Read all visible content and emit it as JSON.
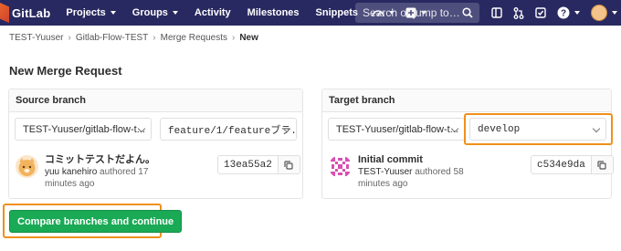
{
  "nav": {
    "brand": "GitLab",
    "items": [
      {
        "label": "Projects",
        "has_caret": true
      },
      {
        "label": "Groups",
        "has_caret": true
      },
      {
        "label": "Activity",
        "has_caret": false
      },
      {
        "label": "Milestones",
        "has_caret": false
      },
      {
        "label": "Snippets",
        "has_caret": false
      }
    ],
    "search_placeholder": "Search or jump to…",
    "icons": [
      "dashboard-icon",
      "plus-icon",
      "search-icon",
      "sidebar-icon",
      "merge-request-icon",
      "todo-icon",
      "help-icon",
      "user-avatar"
    ]
  },
  "breadcrumb": {
    "items": [
      "TEST-Yuuser",
      "Gitlab-Flow-TEST",
      "Merge Requests"
    ],
    "current": "New"
  },
  "page_title": "New Merge Request",
  "source": {
    "heading": "Source branch",
    "project": "TEST-Yuuser/gitlab-flow-t...",
    "branch": "feature/1/featureブラ...",
    "commit": {
      "title": "コミットテストだよん。",
      "author": "yuu kanehiro",
      "meta": "authored 17 minutes ago",
      "sha": "13ea55a2"
    }
  },
  "target": {
    "heading": "Target branch",
    "project": "TEST-Yuuser/gitlab-flow-t...",
    "branch": "develop",
    "commit": {
      "title": "Initial commit",
      "author": "TEST-Yuuser",
      "meta": "authored 58 minutes ago",
      "sha": "c534e9da"
    }
  },
  "compare_button": "Compare branches and continue",
  "colors": {
    "navbar": "#292961",
    "primary_button": "#1aaa55",
    "highlight": "#f0901c"
  }
}
